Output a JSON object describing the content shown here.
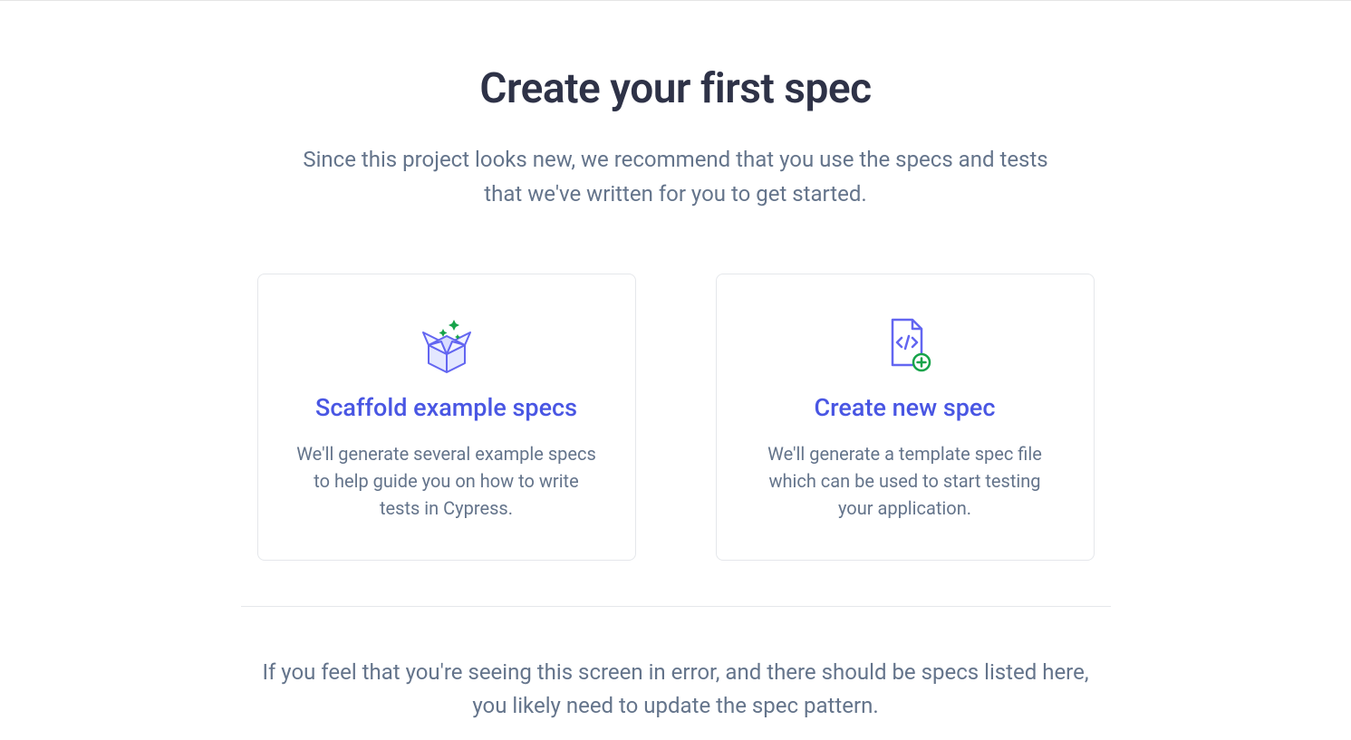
{
  "header": {
    "title": "Create your first spec",
    "subtitle": "Since this project looks new, we recommend that you use the specs and tests that we've written for you to get started."
  },
  "cards": [
    {
      "title": "Scaffold example specs",
      "description": "We'll generate several example specs to help guide you on how to write tests in Cypress."
    },
    {
      "title": "Create new spec",
      "description": "We'll generate a template spec file which can be used to start testing your application."
    }
  ],
  "footer": {
    "note": "If you feel that you're seeing this screen in error, and there should be specs listed here, you likely need to update the spec pattern."
  }
}
